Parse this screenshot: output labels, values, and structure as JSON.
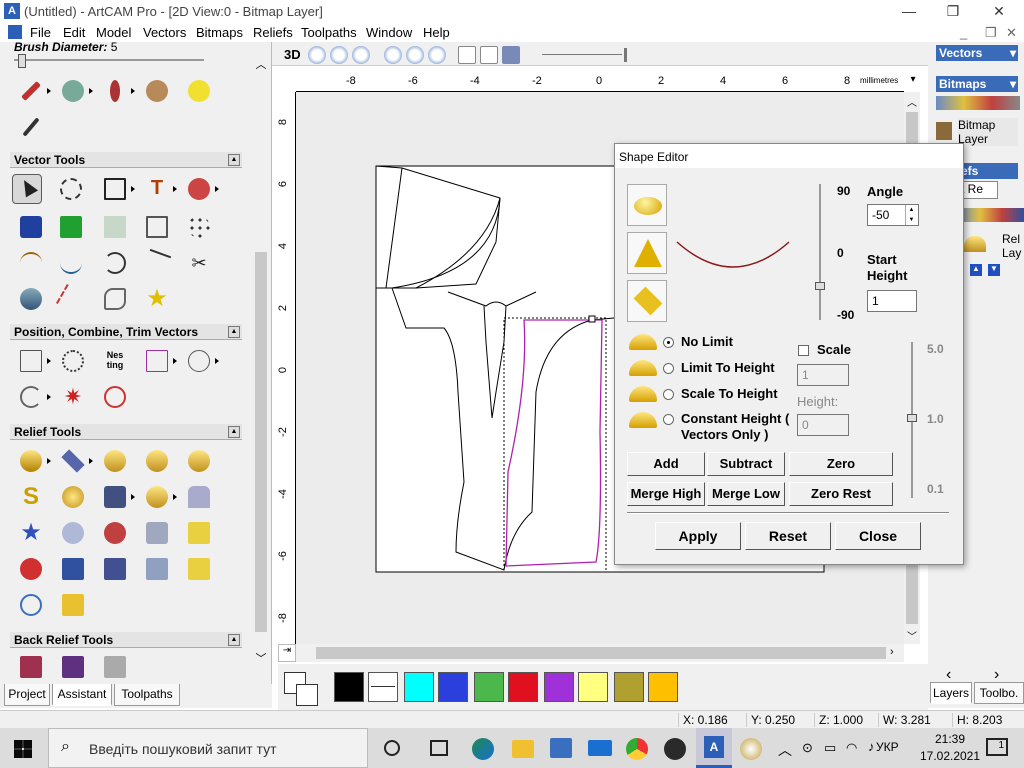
{
  "window": {
    "title": "(Untitled) - ArtCAM Pro - [2D View:0 - Bitmap Layer]",
    "app_icon": "artcam-logo-icon"
  },
  "menu": [
    "File",
    "Edit",
    "Model",
    "Vectors",
    "Bitmaps",
    "Reliefs",
    "Toolpaths",
    "Window",
    "Help"
  ],
  "left_panel": {
    "brush_label": "Brush Diameter:",
    "brush_value": "5",
    "vector_tools": "Vector Tools",
    "position_tools": "Position, Combine, Trim Vectors",
    "relief_tools": "Relief Tools",
    "back_relief_tools": "Back Relief Tools",
    "tabs": [
      "Project",
      "Assistant",
      "Toolpaths"
    ]
  },
  "view_toolbar": {
    "mode": "3D"
  },
  "ruler": {
    "ticks_x": [
      "-8",
      "-6",
      "-4",
      "-2",
      "0",
      "2",
      "4",
      "6",
      "8"
    ],
    "unit": "millimetres",
    "ticks_y": [
      "8",
      "6",
      "4",
      "2",
      "0",
      "-2",
      "-4",
      "-6",
      "-8"
    ]
  },
  "palette": {
    "colors": [
      "#000000",
      "#ffffff",
      "#00ffff",
      "#2a3fdc",
      "#4cb84c",
      "#e01020",
      "#a030d8",
      "#ffff80",
      "#b0a030",
      "#ffc000"
    ]
  },
  "right_panel": {
    "vectors": "Vectors",
    "bitmaps": "Bitmaps",
    "bitmap_layer": "Bitmap Layer",
    "reliefs_partial": "efs",
    "relief_combo_partial": "t Re",
    "relief_layer_partial": "Rel Lay",
    "tabs": [
      "Layers",
      "Toolbo."
    ]
  },
  "status": {
    "x": "X: 0.186",
    "y": "Y: 0.250",
    "z": "Z: 1.000",
    "w": "W: 3.281",
    "h": "H: 8.203"
  },
  "dialog": {
    "title": "Shape Editor",
    "angle_label": "Angle",
    "angle_value": "-50",
    "scale_top": "90",
    "scale_mid": "0",
    "scale_bot": "-90",
    "start_height_label": "Start Height",
    "start_height_value": "1",
    "options": [
      "No Limit",
      "Limit To Height",
      "Scale To Height",
      "Constant Height ( Vectors Only )"
    ],
    "selected_option": 0,
    "scale_label": "Scale",
    "scale_value": "1",
    "height_label": "Height:",
    "height_value": "0",
    "right_scale": [
      "5.0",
      "1.0",
      "0.1"
    ],
    "buttons": {
      "add": "Add",
      "subtract": "Subtract",
      "zero": "Zero",
      "merge_high": "Merge High",
      "merge_low": "Merge Low",
      "zero_rest": "Zero Rest",
      "apply": "Apply",
      "reset": "Reset",
      "close": "Close"
    }
  },
  "taskbar": {
    "search_placeholder": "Введіть пошуковий запит тут",
    "lang": "УКР",
    "time": "21:39",
    "date": "17.02.2021",
    "notifications": "1"
  }
}
